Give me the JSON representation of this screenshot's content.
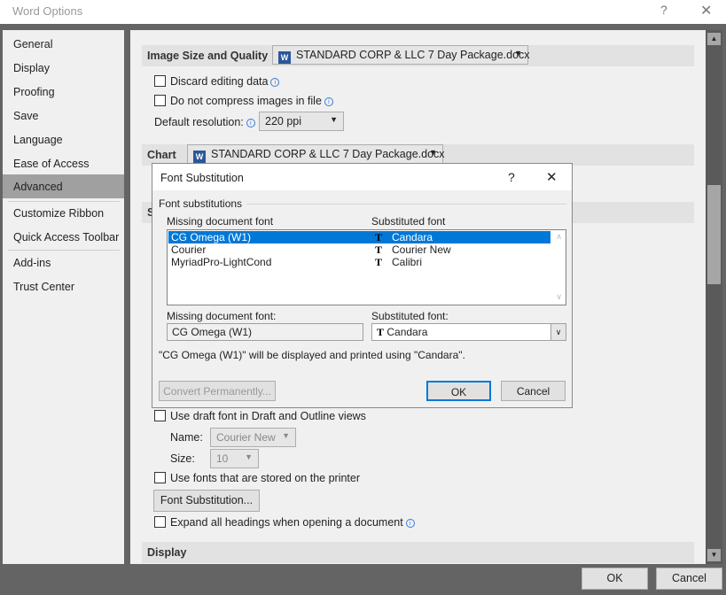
{
  "window": {
    "title": "Word Options",
    "help": "?",
    "close": "✕"
  },
  "sidebar": {
    "items": [
      {
        "label": "General"
      },
      {
        "label": "Display"
      },
      {
        "label": "Proofing"
      },
      {
        "label": "Save"
      },
      {
        "label": "Language"
      },
      {
        "label": "Ease of Access"
      },
      {
        "label": "Advanced",
        "selected": true
      },
      {
        "label": "Customize Ribbon"
      },
      {
        "label": "Quick Access Toolbar"
      },
      {
        "label": "Add-ins"
      },
      {
        "label": "Trust Center"
      }
    ]
  },
  "main": {
    "image_section": {
      "title": "Image Size and Quality",
      "document": "STANDARD CORP & LLC 7 Day Package.docx",
      "discard": "Discard editing data",
      "no_compress": "Do not compress images in file",
      "resolution_label": "Default resolution:",
      "resolution": "220 ppi"
    },
    "chart_section": {
      "title": "Chart",
      "document": "STANDARD CORP & LLC 7 Day Package.docx"
    },
    "show_section": {
      "title": "S"
    },
    "draft_font": "Use draft font in Draft and Outline views",
    "name_label": "Name:",
    "name_value": "Courier New",
    "size_label": "Size:",
    "size_value": "10",
    "printer_fonts": "Use fonts that are stored on the printer",
    "font_sub_button": "Font Substitution...",
    "expand_headings": "Expand all headings when opening a document",
    "display_section": {
      "title": "Display"
    }
  },
  "footer": {
    "ok": "OK",
    "cancel": "Cancel"
  },
  "dialog": {
    "title": "Font Substitution",
    "help": "?",
    "close": "✕",
    "group": "Font substitutions",
    "col_missing": "Missing document font",
    "col_sub": "Substituted font",
    "rows": [
      {
        "missing": "CG Omega (W1)",
        "sub": "Candara"
      },
      {
        "missing": "Courier",
        "sub": "Courier New"
      },
      {
        "missing": "MyriadPro-LightCond",
        "sub": "Calibri"
      }
    ],
    "missing_label": "Missing document font:",
    "missing_value": "CG Omega (W1)",
    "sub_label": "Substituted font:",
    "sub_value": "Candara",
    "message": "\"CG Omega (W1)\" will be displayed and printed using \"Candara\".",
    "convert": "Convert Permanently...",
    "ok": "OK",
    "cancel": "Cancel"
  },
  "colors": {
    "accent": "#0078d7",
    "frame": "#646464"
  }
}
